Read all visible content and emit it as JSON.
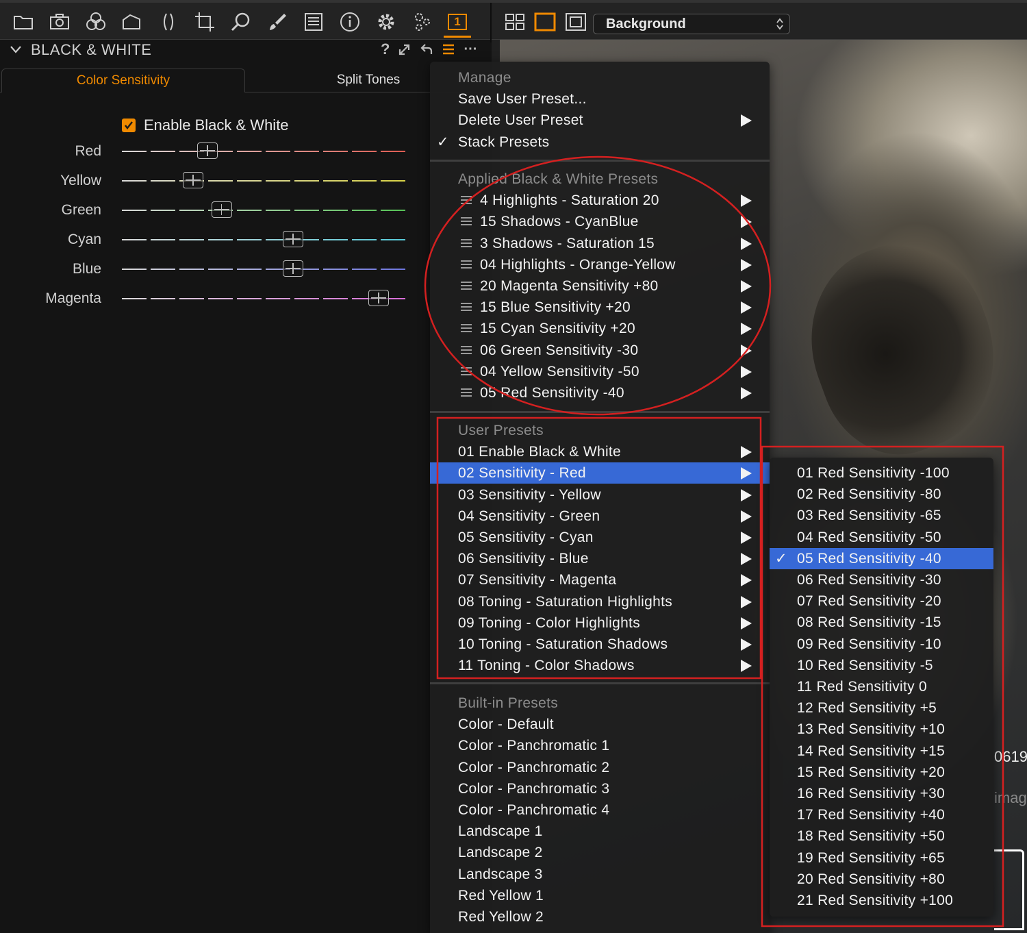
{
  "toolbar": {
    "icons": [
      "folder-icon",
      "camera-icon",
      "color-circles-icon",
      "lens-icon",
      "keystone-icon",
      "crop-icon",
      "loupe-icon",
      "brush-icon",
      "metadata-icon",
      "info-icon",
      "settings-icon",
      "batch-icon"
    ],
    "active_tab_number": "1",
    "background_select": "Background"
  },
  "panel": {
    "title": "BLACK & WHITE",
    "help": "?",
    "tabs": [
      "Color Sensitivity",
      "Split Tones"
    ],
    "enable_label": "Enable Black & White",
    "enabled": true,
    "sliders": [
      {
        "label": "Red",
        "value_fraction": 0.3,
        "color": "#e0463a"
      },
      {
        "label": "Yellow",
        "value_fraction": 0.25,
        "color": "#d8d12c"
      },
      {
        "label": "Green",
        "value_fraction": 0.35,
        "color": "#3fbf3f"
      },
      {
        "label": "Cyan",
        "value_fraction": 0.6,
        "color": "#3fc8d8"
      },
      {
        "label": "Blue",
        "value_fraction": 0.6,
        "color": "#5a64e0"
      },
      {
        "label": "Magenta",
        "value_fraction": 0.9,
        "color": "#d85ad8"
      }
    ],
    "accent": "#f08a00"
  },
  "menu": {
    "manage_header": "Manage",
    "manage_items": [
      {
        "label": "Save User Preset...",
        "submenu": false,
        "checked": false
      },
      {
        "label": "Delete User Preset",
        "submenu": true,
        "checked": false
      },
      {
        "label": "Stack Presets",
        "submenu": false,
        "checked": true
      }
    ],
    "applied_header": "Applied Black & White Presets",
    "applied_items": [
      "4 Highlights - Saturation 20",
      "15 Shadows - CyanBlue",
      "3 Shadows - Saturation 15",
      "04 Highlights - Orange-Yellow",
      "20 Magenta Sensitivity +80",
      "15 Blue Sensitivity +20",
      "15 Cyan Sensitivity +20",
      "06 Green Sensitivity -30",
      "04 Yellow Sensitivity -50",
      "05 Red Sensitivity -40"
    ],
    "user_header": "User Presets",
    "user_items": [
      "01 Enable Black & White",
      "02 Sensitivity - Red",
      "03 Sensitivity - Yellow",
      "04 Sensitivity - Green",
      "05 Sensitivity - Cyan",
      "06 Sensitivity - Blue",
      "07 Sensitivity - Magenta",
      "08 Toning - Saturation Highlights",
      "09 Toning - Color Highlights",
      "10 Toning - Saturation Shadows",
      "11 Toning - Color Shadows"
    ],
    "user_selected_index": 1,
    "builtin_header": "Built-in Presets",
    "builtin_items": [
      "Color - Default",
      "Color - Panchromatic 1",
      "Color - Panchromatic 2",
      "Color - Panchromatic 3",
      "Color - Panchromatic 4",
      "Landscape 1",
      "Landscape 2",
      "Landscape 3",
      "Red Yellow 1",
      "Red Yellow 2"
    ],
    "highlight_color": "#3769d6"
  },
  "submenu": {
    "items": [
      "01 Red Sensitivity -100",
      "02 Red Sensitivity -80",
      "03 Red Sensitivity -65",
      "04 Red Sensitivity -50",
      "05 Red Sensitivity -40",
      "06 Red Sensitivity -30",
      "07 Red Sensitivity -20",
      "08 Red Sensitivity -15",
      "09 Red Sensitivity -10",
      "10 Red Sensitivity -5",
      "11 Red Sensitivity 0",
      "12 Red Sensitivity +5",
      "13 Red Sensitivity +10",
      "14 Red Sensitivity +15",
      "15 Red Sensitivity +20",
      "16 Red Sensitivity +30",
      "17 Red Sensitivity +40",
      "18 Red Sensitivity +50",
      "19 Red Sensitivity +65",
      "20 Red Sensitivity +80",
      "21 Red Sensitivity +100"
    ],
    "checked_index": 4
  },
  "viewer": {
    "partial_text_1": "0619",
    "partial_text_2": "imag"
  },
  "annotation_color": "#d42020"
}
